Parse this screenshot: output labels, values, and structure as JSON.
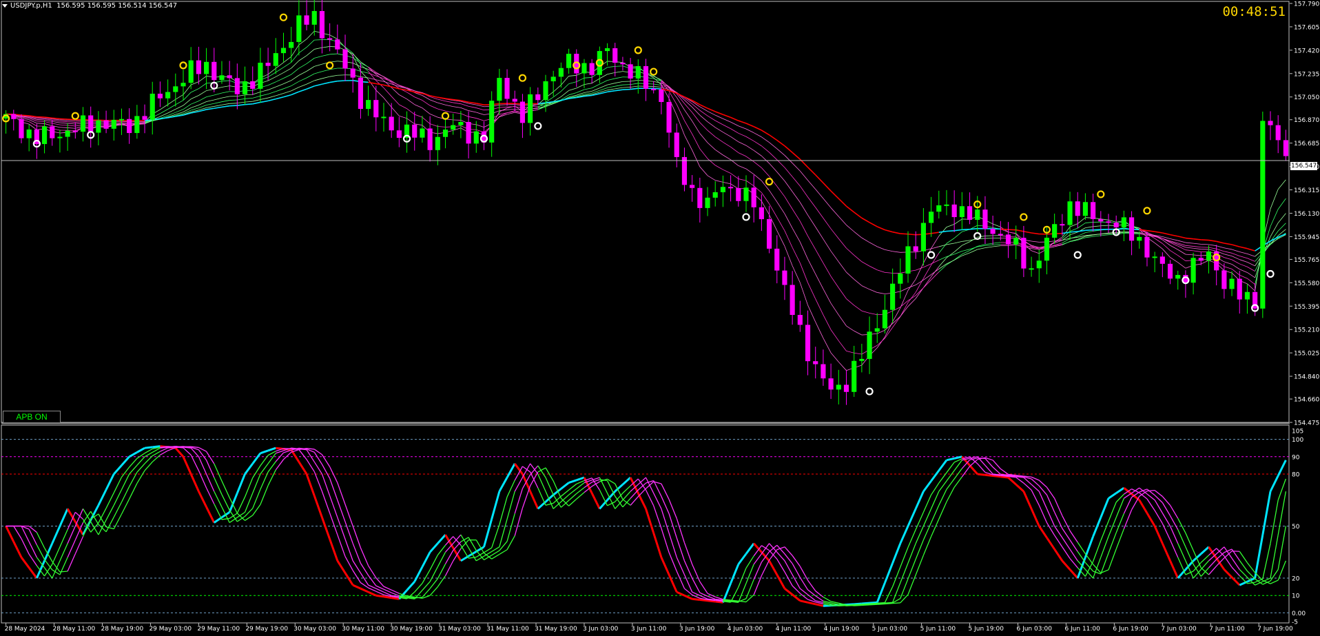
{
  "header": {
    "symbol": "USDJPY.p,H1",
    "ohlc": "156.595 156.595 156.514 156.547"
  },
  "timer": "00:48:51",
  "apb_button": "APB ON",
  "current_price_label": "156.547",
  "colors": {
    "background": "#000000",
    "bull_candle": "#00ff00",
    "bear_candle": "#ff00ff",
    "ribbon_bull": "#00e5ff",
    "ribbon_bear": "#ff0000",
    "signal_marker": "#ffd700",
    "timer": "#ffd700"
  },
  "chart_data": [
    {
      "type": "candlestick",
      "panel": "main",
      "symbol": "USDJPY.p",
      "timeframe": "H1",
      "y_tick_labels": [
        "157.790",
        "157.605",
        "157.420",
        "157.235",
        "157.050",
        "156.870",
        "156.685",
        "156.500",
        "156.315",
        "156.130",
        "155.945",
        "155.765",
        "155.580",
        "155.395",
        "155.210",
        "155.025",
        "154.840",
        "154.660",
        "154.475"
      ],
      "ylim": [
        154.475,
        157.79
      ],
      "current_price": 156.547,
      "x_tick_labels": [
        "28 May 2024",
        "28 May 11:00",
        "28 May 19:00",
        "29 May 03:00",
        "29 May 11:00",
        "29 May 19:00",
        "30 May 03:00",
        "30 May 11:00",
        "30 May 19:00",
        "31 May 03:00",
        "31 May 11:00",
        "31 May 19:00",
        "3 Jun 03:00",
        "3 Jun 11:00",
        "3 Jun 19:00",
        "4 Jun 03:00",
        "4 Jun 11:00",
        "4 Jun 19:00",
        "5 Jun 03:00",
        "5 Jun 11:00",
        "5 Jun 19:00",
        "6 Jun 03:00",
        "6 Jun 11:00",
        "6 Jun 19:00",
        "7 Jun 03:00",
        "7 Jun 11:00",
        "7 Jun 19:00"
      ],
      "close_path": [
        [
          0,
          156.88
        ],
        [
          4,
          156.72
        ],
        [
          8,
          156.78
        ],
        [
          12,
          156.85
        ],
        [
          16,
          156.82
        ],
        [
          20,
          157.05
        ],
        [
          24,
          157.25
        ],
        [
          26,
          157.3
        ],
        [
          30,
          157.1
        ],
        [
          34,
          157.3
        ],
        [
          38,
          157.62
        ],
        [
          40,
          157.68
        ],
        [
          42,
          157.5
        ],
        [
          44,
          157.28
        ],
        [
          46,
          157.05
        ],
        [
          48,
          156.9
        ],
        [
          50,
          156.8
        ],
        [
          52,
          156.78
        ],
        [
          55,
          156.7
        ],
        [
          58,
          156.82
        ],
        [
          62,
          156.72
        ],
        [
          64,
          157.2
        ],
        [
          67,
          156.88
        ],
        [
          70,
          157.18
        ],
        [
          73,
          157.32
        ],
        [
          76,
          157.28
        ],
        [
          78,
          157.42
        ],
        [
          80,
          157.3
        ],
        [
          83,
          157.15
        ],
        [
          85,
          157.05
        ],
        [
          87,
          156.5
        ],
        [
          89,
          156.3
        ],
        [
          91,
          156.2
        ],
        [
          93,
          156.35
        ],
        [
          95,
          156.3
        ],
        [
          97,
          156.2
        ],
        [
          99,
          155.9
        ],
        [
          101,
          155.5
        ],
        [
          103,
          155.2
        ],
        [
          105,
          154.9
        ],
        [
          107,
          154.72
        ],
        [
          109,
          154.8
        ],
        [
          111,
          155.0
        ],
        [
          114,
          155.4
        ],
        [
          117,
          155.8
        ],
        [
          120,
          156.15
        ],
        [
          123,
          156.18
        ],
        [
          126,
          156.08
        ],
        [
          128,
          156.0
        ],
        [
          131,
          155.85
        ],
        [
          133,
          155.68
        ],
        [
          135,
          155.9
        ],
        [
          138,
          156.2
        ],
        [
          141,
          156.1
        ],
        [
          144,
          156.05
        ],
        [
          147,
          155.92
        ],
        [
          150,
          155.68
        ],
        [
          152,
          155.62
        ],
        [
          154,
          155.7
        ],
        [
          156,
          155.82
        ],
        [
          158,
          155.58
        ],
        [
          160,
          155.48
        ],
        [
          162,
          155.45
        ],
        [
          163,
          156.85
        ],
        [
          165,
          156.72
        ],
        [
          166,
          156.55
        ]
      ],
      "signals": [
        {
          "bar": 0,
          "kind": "sell",
          "price": 156.88
        },
        {
          "bar": 4,
          "kind": "buy",
          "price": 156.68
        },
        {
          "bar": 9,
          "kind": "sell",
          "price": 156.9
        },
        {
          "bar": 11,
          "kind": "buy",
          "price": 156.75
        },
        {
          "bar": 23,
          "kind": "sell",
          "price": 157.3
        },
        {
          "bar": 27,
          "kind": "buy",
          "price": 157.14
        },
        {
          "bar": 36,
          "kind": "sell",
          "price": 157.68
        },
        {
          "bar": 42,
          "kind": "sell",
          "price": 157.3
        },
        {
          "bar": 52,
          "kind": "buy",
          "price": 156.72
        },
        {
          "bar": 57,
          "kind": "sell",
          "price": 156.9
        },
        {
          "bar": 62,
          "kind": "buy",
          "price": 156.72
        },
        {
          "bar": 67,
          "kind": "sell",
          "price": 157.2
        },
        {
          "bar": 69,
          "kind": "buy",
          "price": 156.82
        },
        {
          "bar": 74,
          "kind": "sell",
          "price": 157.3
        },
        {
          "bar": 77,
          "kind": "sell",
          "price": 157.32
        },
        {
          "bar": 82,
          "kind": "sell",
          "price": 157.42
        },
        {
          "bar": 84,
          "kind": "sell",
          "price": 157.25
        },
        {
          "bar": 96,
          "kind": "buy",
          "price": 156.1
        },
        {
          "bar": 99,
          "kind": "sell",
          "price": 156.38
        },
        {
          "bar": 112,
          "kind": "buy",
          "price": 154.72
        },
        {
          "bar": 120,
          "kind": "buy",
          "price": 155.8
        },
        {
          "bar": 126,
          "kind": "buy",
          "price": 155.95
        },
        {
          "bar": 126,
          "kind": "sell",
          "price": 156.2
        },
        {
          "bar": 132,
          "kind": "sell",
          "price": 156.1
        },
        {
          "bar": 135,
          "kind": "sell",
          "price": 156.0
        },
        {
          "bar": 139,
          "kind": "buy",
          "price": 155.8
        },
        {
          "bar": 142,
          "kind": "sell",
          "price": 156.28
        },
        {
          "bar": 144,
          "kind": "buy",
          "price": 155.98
        },
        {
          "bar": 148,
          "kind": "sell",
          "price": 156.15
        },
        {
          "bar": 153,
          "kind": "buy",
          "price": 155.6
        },
        {
          "bar": 157,
          "kind": "sell",
          "price": 155.78
        },
        {
          "bar": 162,
          "kind": "buy",
          "price": 155.38
        },
        {
          "bar": 164,
          "kind": "buy",
          "price": 155.65
        }
      ]
    },
    {
      "type": "line",
      "panel": "oscillator",
      "y_tick_labels": [
        "105",
        "100",
        "90",
        "80",
        "50",
        "20",
        "10",
        "0.00",
        "-5"
      ],
      "ylim": [
        -5,
        105
      ],
      "levels": [
        {
          "value": 100,
          "color": "#6fa0c8"
        },
        {
          "value": 90,
          "color": "#ff00ff"
        },
        {
          "value": 80,
          "color": "#ff0000"
        },
        {
          "value": 50,
          "color": "#6fa0c8"
        },
        {
          "value": 20,
          "color": "#6fa0c8"
        },
        {
          "value": 10,
          "color": "#00ff00"
        },
        {
          "value": 0,
          "color": "#6fa0c8"
        }
      ],
      "main_line": [
        [
          0,
          50
        ],
        [
          2,
          32
        ],
        [
          4,
          20
        ],
        [
          6,
          40
        ],
        [
          8,
          60
        ],
        [
          10,
          45
        ],
        [
          12,
          62
        ],
        [
          14,
          80
        ],
        [
          16,
          90
        ],
        [
          18,
          95
        ],
        [
          20,
          96
        ],
        [
          22,
          95
        ],
        [
          23,
          90
        ],
        [
          25,
          70
        ],
        [
          27,
          52
        ],
        [
          29,
          58
        ],
        [
          31,
          80
        ],
        [
          33,
          92
        ],
        [
          35,
          95
        ],
        [
          37,
          94
        ],
        [
          39,
          80
        ],
        [
          41,
          55
        ],
        [
          43,
          30
        ],
        [
          45,
          16
        ],
        [
          48,
          10
        ],
        [
          51,
          8
        ],
        [
          53,
          18
        ],
        [
          55,
          35
        ],
        [
          57,
          45
        ],
        [
          59,
          30
        ],
        [
          62,
          38
        ],
        [
          64,
          70
        ],
        [
          66,
          86
        ],
        [
          67,
          80
        ],
        [
          69,
          60
        ],
        [
          71,
          68
        ],
        [
          73,
          75
        ],
        [
          75,
          78
        ],
        [
          77,
          60
        ],
        [
          79,
          70
        ],
        [
          81,
          78
        ],
        [
          83,
          60
        ],
        [
          85,
          32
        ],
        [
          87,
          12
        ],
        [
          89,
          8
        ],
        [
          93,
          6
        ],
        [
          95,
          28
        ],
        [
          97,
          40
        ],
        [
          99,
          30
        ],
        [
          101,
          14
        ],
        [
          103,
          7
        ],
        [
          106,
          4
        ],
        [
          110,
          5
        ],
        [
          113,
          6
        ],
        [
          116,
          40
        ],
        [
          119,
          70
        ],
        [
          122,
          88
        ],
        [
          124,
          90
        ],
        [
          126,
          80
        ],
        [
          130,
          78
        ],
        [
          132,
          70
        ],
        [
          134,
          50
        ],
        [
          137,
          30
        ],
        [
          139,
          20
        ],
        [
          141,
          44
        ],
        [
          143,
          66
        ],
        [
          145,
          72
        ],
        [
          147,
          65
        ],
        [
          149,
          50
        ],
        [
          152,
          20
        ],
        [
          154,
          30
        ],
        [
          156,
          38
        ],
        [
          158,
          25
        ],
        [
          160,
          16
        ],
        [
          162,
          20
        ],
        [
          164,
          70
        ],
        [
          166,
          88
        ]
      ]
    }
  ]
}
